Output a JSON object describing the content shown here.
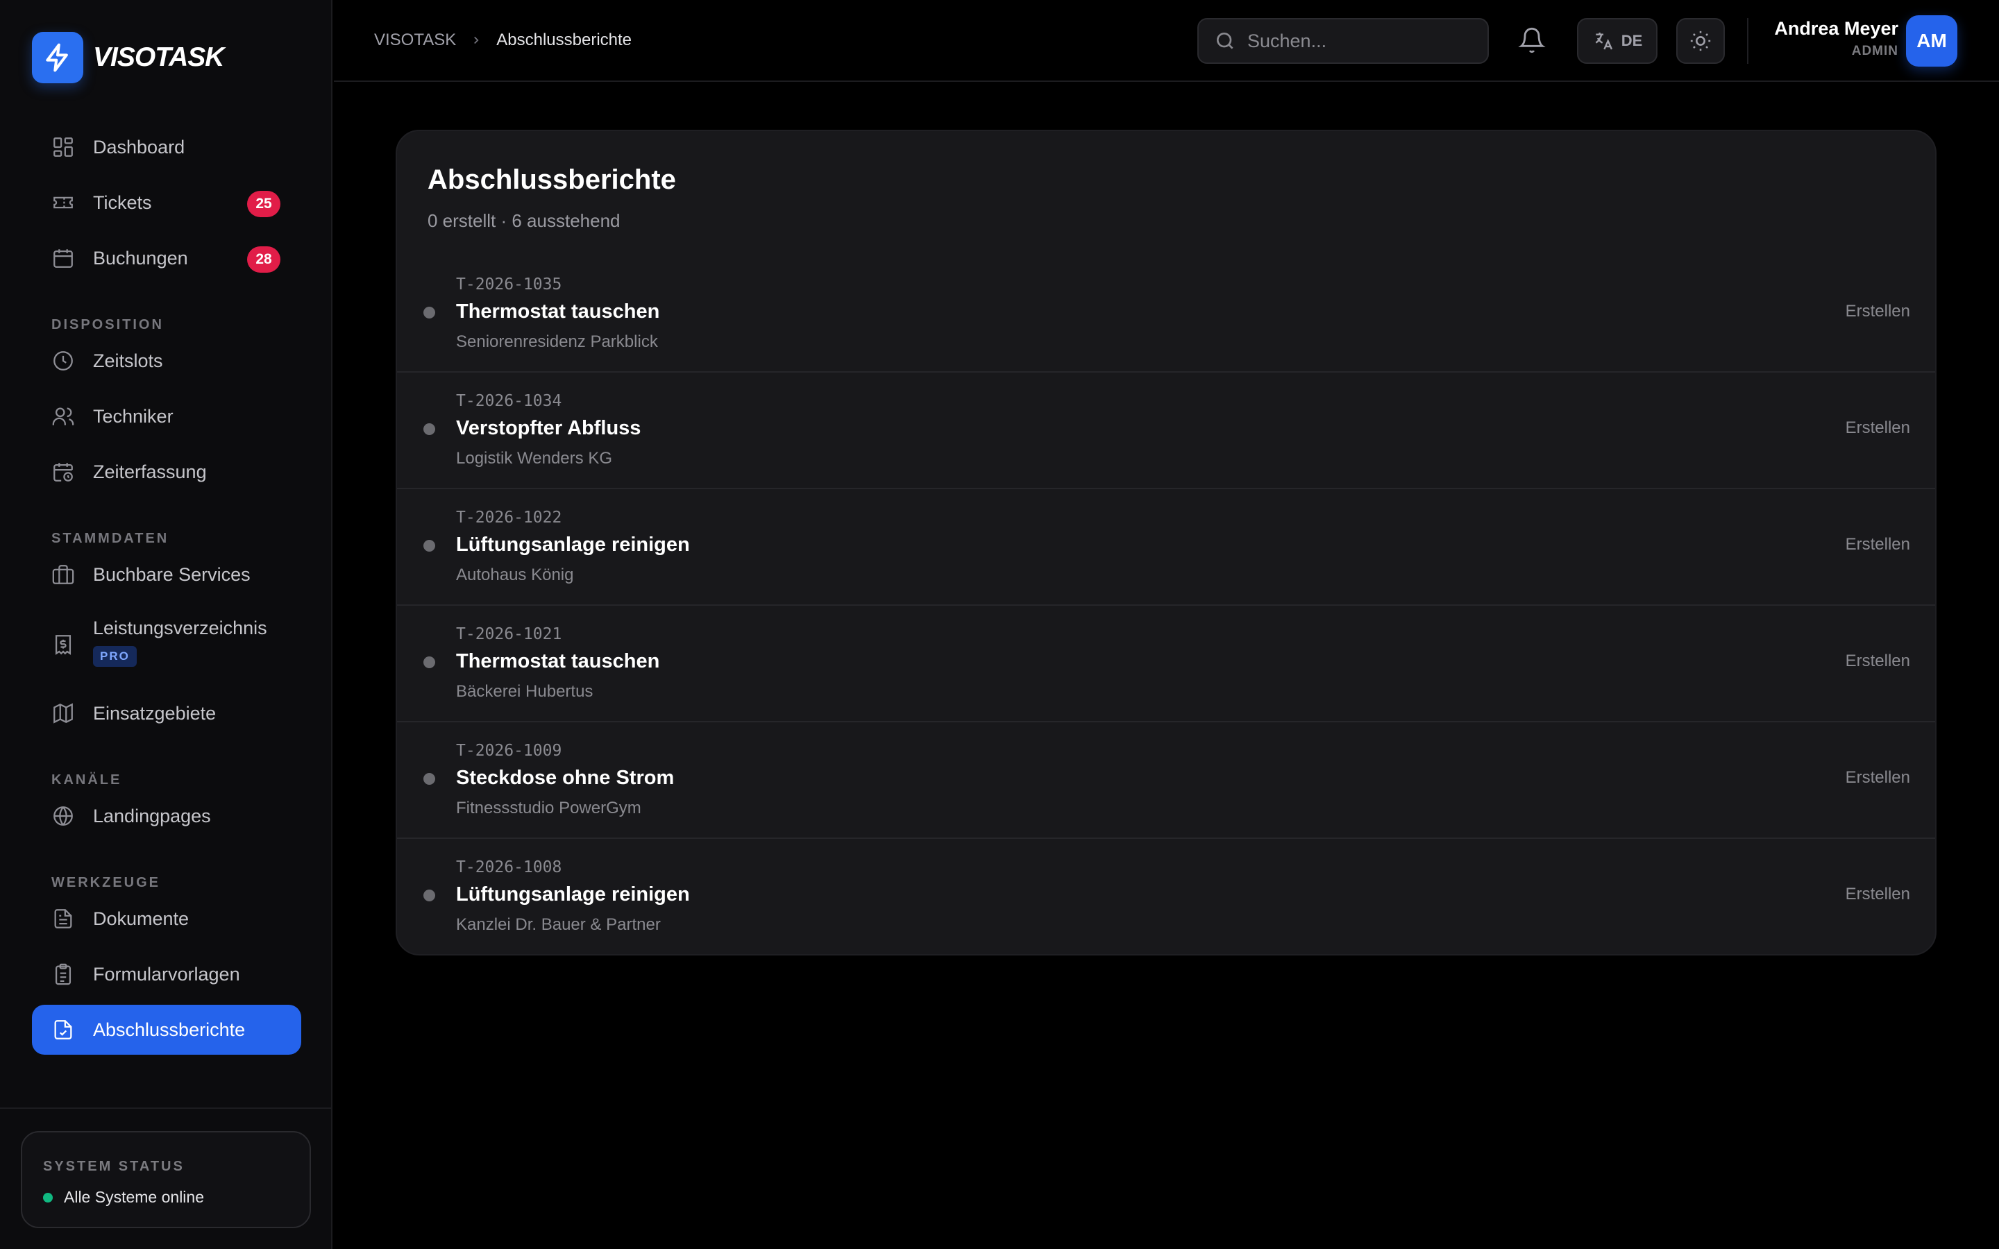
{
  "brand": {
    "name": "VISOTASK",
    "accent": "#2563eb"
  },
  "sidebar": {
    "main": [
      {
        "label": "Dashboard",
        "icon": "dashboard-icon"
      },
      {
        "label": "Tickets",
        "icon": "ticket-icon",
        "badge": "25"
      },
      {
        "label": "Buchungen",
        "icon": "calendar-icon",
        "badge": "28"
      }
    ],
    "sections": {
      "disposition": "DISPOSITION",
      "stammdaten": "STAMMDATEN",
      "kanaele": "KANÄLE",
      "werkzeuge": "WERKZEUGE"
    },
    "disposition": [
      {
        "label": "Zeitslots",
        "icon": "clock-icon"
      },
      {
        "label": "Techniker",
        "icon": "users-icon"
      },
      {
        "label": "Zeiterfassung",
        "icon": "calendar-clock-icon"
      }
    ],
    "stammdaten": [
      {
        "label": "Buchbare Services",
        "icon": "briefcase-icon"
      },
      {
        "label": "Leistungsverzeichnis",
        "icon": "receipt-icon",
        "tag": "PRO"
      },
      {
        "label": "Einsatzgebiete",
        "icon": "map-icon"
      }
    ],
    "kanaele": [
      {
        "label": "Landingpages",
        "icon": "globe-icon"
      }
    ],
    "werkzeuge": [
      {
        "label": "Dokumente",
        "icon": "document-icon"
      },
      {
        "label": "Formularvorlagen",
        "icon": "clipboard-icon"
      },
      {
        "label": "Abschlussberichte",
        "icon": "report-icon",
        "active": true
      }
    ],
    "status": {
      "title": "SYSTEM STATUS",
      "text": "Alle Systeme online",
      "color": "#10b981"
    }
  },
  "header": {
    "breadcrumb": {
      "root": "VISOTASK",
      "current": "Abschlussberichte"
    },
    "search_placeholder": "Suchen...",
    "lang": "DE",
    "user": {
      "name": "Andrea Meyer",
      "role": "ADMIN",
      "initials": "AM"
    }
  },
  "main": {
    "title": "Abschlussberichte",
    "subtitle": "0 erstellt · 6 ausstehend",
    "reports": [
      {
        "id": "T-2026-1035",
        "title": "Thermostat tauschen",
        "client": "Seniorenresidenz Parkblick",
        "action": "Erstellen"
      },
      {
        "id": "T-2026-1034",
        "title": "Verstopfter Abfluss",
        "client": "Logistik Wenders KG",
        "action": "Erstellen"
      },
      {
        "id": "T-2026-1022",
        "title": "Lüftungsanlage reinigen",
        "client": "Autohaus König",
        "action": "Erstellen"
      },
      {
        "id": "T-2026-1021",
        "title": "Thermostat tauschen",
        "client": "Bäckerei Hubertus",
        "action": "Erstellen"
      },
      {
        "id": "T-2026-1009",
        "title": "Steckdose ohne Strom",
        "client": "Fitnessstudio PowerGym",
        "action": "Erstellen"
      },
      {
        "id": "T-2026-1008",
        "title": "Lüftungsanlage reinigen",
        "client": "Kanzlei Dr. Bauer & Partner",
        "action": "Erstellen"
      }
    ]
  }
}
